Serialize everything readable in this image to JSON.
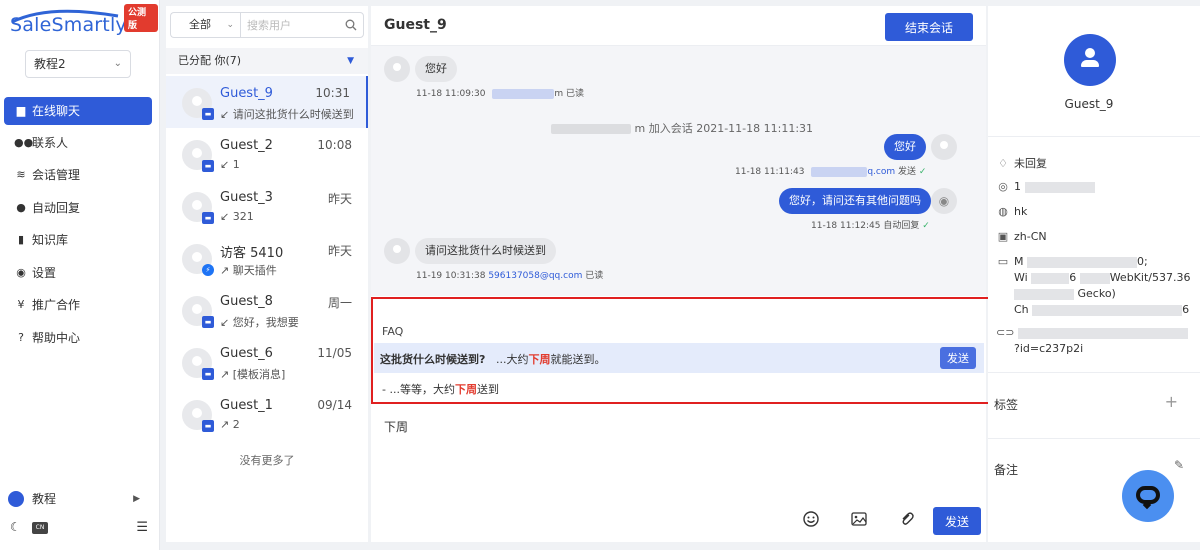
{
  "brand": {
    "logo_text": "SaleSmartly",
    "badge": "公测版"
  },
  "workspace": {
    "selected": "教程2"
  },
  "nav": {
    "items": [
      {
        "label": "在线聊天",
        "icon": "chat-icon"
      },
      {
        "label": "联系人",
        "icon": "contacts-icon"
      },
      {
        "label": "会话管理",
        "icon": "layers-icon"
      },
      {
        "label": "自动回复",
        "icon": "robot-icon"
      },
      {
        "label": "知识库",
        "icon": "book-icon"
      },
      {
        "label": "设置",
        "icon": "gear-icon"
      },
      {
        "label": "推广合作",
        "icon": "yen-icon"
      },
      {
        "label": "帮助中心",
        "icon": "help-icon"
      }
    ],
    "user": "教程",
    "lang_badge": "CN"
  },
  "list": {
    "filter": "全部",
    "search_placeholder": "搜索用户",
    "assigned_label": "已分配  你(7)",
    "conversations": [
      {
        "name": "Guest_9",
        "time": "10:31",
        "preview": "↙ 请问这批货什么时候送到"
      },
      {
        "name": "Guest_2",
        "time": "10:08",
        "preview": "↙ 1"
      },
      {
        "name": "Guest_3",
        "time": "昨天",
        "preview": "↙ 321"
      },
      {
        "name": "访客 5410",
        "time": "昨天",
        "preview": "↗ 聊天插件"
      },
      {
        "name": "Guest_8",
        "time": "周一",
        "preview": "↙ 您好，我想要"
      },
      {
        "name": "Guest_6",
        "time": "11/05",
        "preview": "↗ [模板消息]"
      },
      {
        "name": "Guest_1",
        "time": "09/14",
        "preview": "↗ 2"
      }
    ],
    "no_more": "没有更多了"
  },
  "chat": {
    "title": "Guest_9",
    "end_button": "结束会话",
    "messages": [
      {
        "text": "您好",
        "meta_time": "11-18 11:09:30",
        "meta_tail": "m",
        "status": "已读"
      },
      {
        "text": "您好",
        "meta_time": "11-18 11:11:43",
        "email": "q.com",
        "status": "发送"
      },
      {
        "text": "您好，请问还有其他问题吗",
        "meta_time": "11-18 11:12:45",
        "status": "自动回复"
      },
      {
        "text": "请问这批货什么时候送到",
        "meta_time": "11-19 10:31:38",
        "email": "596137058@qq.com",
        "status": "已读"
      }
    ],
    "system_note": "m 加入会话 2021-11-18 11:11:31",
    "faq": {
      "title": "FAQ",
      "q1": "这批货什么时候送到?",
      "a1_pre": "...大约",
      "a1_hl": "下周",
      "a1_post": "就能送到。",
      "send": "发送",
      "r2_pre": "-    ...等等，大约",
      "r2_hl": "下周",
      "r2_post": "送到"
    },
    "composer_text": "下周",
    "send_button": "发送"
  },
  "info": {
    "name": "Guest_9",
    "status": "未回复",
    "location_prefix": "1",
    "region": "hk",
    "language": "zh-CN",
    "device_l1": "M",
    "device_l1b": "0;",
    "device_l2a": "Wi",
    "device_l2b": "6",
    "device_l2c": "WebKit/537.36",
    "device_l3": "Gecko)",
    "device_l4a": "Ch",
    "device_l4b": "6",
    "url_l2": "?id=c237p2i",
    "tags_label": "标签",
    "notes_label": "备注"
  },
  "colors": {
    "accent": "#2f5bd8",
    "highlight": "#e23b2e",
    "faq_border": "#e02020"
  }
}
